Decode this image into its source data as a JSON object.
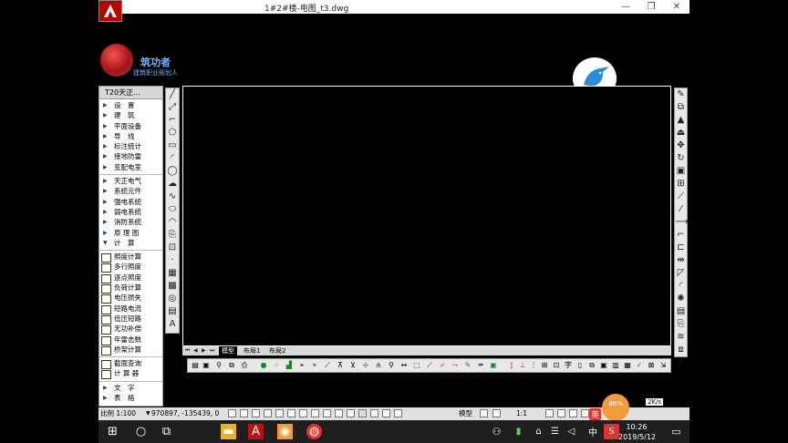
{
  "window": {
    "title": "1#2#楼-电图_t3.dwg",
    "minimize": "—",
    "maximize": "❐",
    "close": "✕"
  },
  "brand": {
    "name": "筑功者",
    "slogan": "建筑职业规划人"
  },
  "palette": {
    "header": "T20天正...",
    "groups": [
      [
        "设　置",
        "建　筑",
        "平面设备",
        "导　线",
        "标注统计",
        "接地防雷",
        "变配电室"
      ],
      [
        "天正电气",
        "系统元件",
        "强电系统",
        "弱电系统",
        "消防系统",
        "原 理 图",
        "计　算"
      ],
      [
        "照度计算",
        "多行照度",
        "逐点照度",
        "负荷计算",
        "电压损失",
        "短路电流",
        "低压短路",
        "无功补偿",
        "年雷击数",
        "桥架计算"
      ],
      [
        "截面查询",
        "计 算 器"
      ],
      [
        "文　字",
        "表　格"
      ]
    ]
  },
  "tabs": {
    "model": "模型",
    "layout1": "布局1",
    "layout2": "布局2"
  },
  "status": {
    "scale": "比例 1:100",
    "coords": "970897, -135439, 0",
    "model": "模型",
    "anno_scale": "1:1",
    "bubble_percent": "86%",
    "netspeed": "2K/s"
  },
  "taskbar": {
    "ime": "英",
    "ime2": "中",
    "time": "10:26",
    "date": "2019/5/12"
  }
}
